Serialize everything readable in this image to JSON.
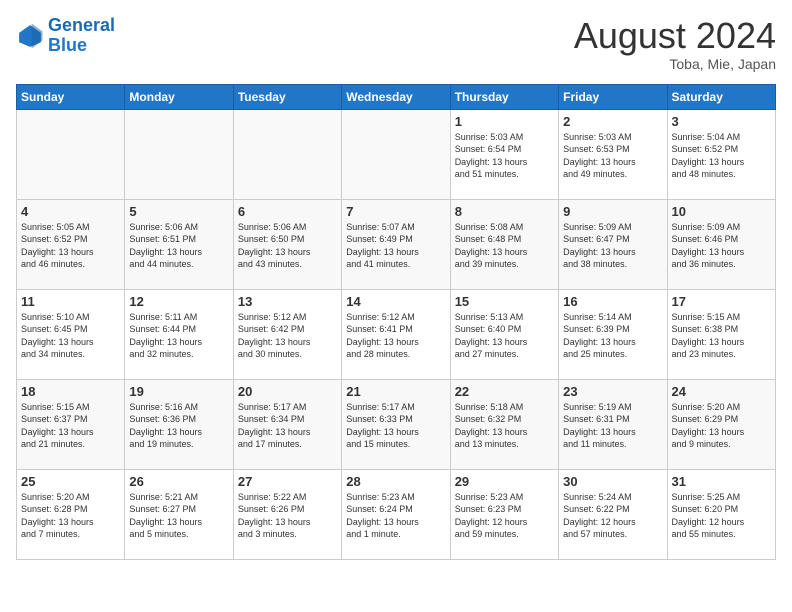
{
  "header": {
    "logo_general": "General",
    "logo_blue": "Blue",
    "month_year": "August 2024",
    "location": "Toba, Mie, Japan"
  },
  "weekdays": [
    "Sunday",
    "Monday",
    "Tuesday",
    "Wednesday",
    "Thursday",
    "Friday",
    "Saturday"
  ],
  "weeks": [
    [
      {
        "day": "",
        "info": ""
      },
      {
        "day": "",
        "info": ""
      },
      {
        "day": "",
        "info": ""
      },
      {
        "day": "",
        "info": ""
      },
      {
        "day": "1",
        "info": "Sunrise: 5:03 AM\nSunset: 6:54 PM\nDaylight: 13 hours\nand 51 minutes."
      },
      {
        "day": "2",
        "info": "Sunrise: 5:03 AM\nSunset: 6:53 PM\nDaylight: 13 hours\nand 49 minutes."
      },
      {
        "day": "3",
        "info": "Sunrise: 5:04 AM\nSunset: 6:52 PM\nDaylight: 13 hours\nand 48 minutes."
      }
    ],
    [
      {
        "day": "4",
        "info": "Sunrise: 5:05 AM\nSunset: 6:52 PM\nDaylight: 13 hours\nand 46 minutes."
      },
      {
        "day": "5",
        "info": "Sunrise: 5:06 AM\nSunset: 6:51 PM\nDaylight: 13 hours\nand 44 minutes."
      },
      {
        "day": "6",
        "info": "Sunrise: 5:06 AM\nSunset: 6:50 PM\nDaylight: 13 hours\nand 43 minutes."
      },
      {
        "day": "7",
        "info": "Sunrise: 5:07 AM\nSunset: 6:49 PM\nDaylight: 13 hours\nand 41 minutes."
      },
      {
        "day": "8",
        "info": "Sunrise: 5:08 AM\nSunset: 6:48 PM\nDaylight: 13 hours\nand 39 minutes."
      },
      {
        "day": "9",
        "info": "Sunrise: 5:09 AM\nSunset: 6:47 PM\nDaylight: 13 hours\nand 38 minutes."
      },
      {
        "day": "10",
        "info": "Sunrise: 5:09 AM\nSunset: 6:46 PM\nDaylight: 13 hours\nand 36 minutes."
      }
    ],
    [
      {
        "day": "11",
        "info": "Sunrise: 5:10 AM\nSunset: 6:45 PM\nDaylight: 13 hours\nand 34 minutes."
      },
      {
        "day": "12",
        "info": "Sunrise: 5:11 AM\nSunset: 6:44 PM\nDaylight: 13 hours\nand 32 minutes."
      },
      {
        "day": "13",
        "info": "Sunrise: 5:12 AM\nSunset: 6:42 PM\nDaylight: 13 hours\nand 30 minutes."
      },
      {
        "day": "14",
        "info": "Sunrise: 5:12 AM\nSunset: 6:41 PM\nDaylight: 13 hours\nand 28 minutes."
      },
      {
        "day": "15",
        "info": "Sunrise: 5:13 AM\nSunset: 6:40 PM\nDaylight: 13 hours\nand 27 minutes."
      },
      {
        "day": "16",
        "info": "Sunrise: 5:14 AM\nSunset: 6:39 PM\nDaylight: 13 hours\nand 25 minutes."
      },
      {
        "day": "17",
        "info": "Sunrise: 5:15 AM\nSunset: 6:38 PM\nDaylight: 13 hours\nand 23 minutes."
      }
    ],
    [
      {
        "day": "18",
        "info": "Sunrise: 5:15 AM\nSunset: 6:37 PM\nDaylight: 13 hours\nand 21 minutes."
      },
      {
        "day": "19",
        "info": "Sunrise: 5:16 AM\nSunset: 6:36 PM\nDaylight: 13 hours\nand 19 minutes."
      },
      {
        "day": "20",
        "info": "Sunrise: 5:17 AM\nSunset: 6:34 PM\nDaylight: 13 hours\nand 17 minutes."
      },
      {
        "day": "21",
        "info": "Sunrise: 5:17 AM\nSunset: 6:33 PM\nDaylight: 13 hours\nand 15 minutes."
      },
      {
        "day": "22",
        "info": "Sunrise: 5:18 AM\nSunset: 6:32 PM\nDaylight: 13 hours\nand 13 minutes."
      },
      {
        "day": "23",
        "info": "Sunrise: 5:19 AM\nSunset: 6:31 PM\nDaylight: 13 hours\nand 11 minutes."
      },
      {
        "day": "24",
        "info": "Sunrise: 5:20 AM\nSunset: 6:29 PM\nDaylight: 13 hours\nand 9 minutes."
      }
    ],
    [
      {
        "day": "25",
        "info": "Sunrise: 5:20 AM\nSunset: 6:28 PM\nDaylight: 13 hours\nand 7 minutes."
      },
      {
        "day": "26",
        "info": "Sunrise: 5:21 AM\nSunset: 6:27 PM\nDaylight: 13 hours\nand 5 minutes."
      },
      {
        "day": "27",
        "info": "Sunrise: 5:22 AM\nSunset: 6:26 PM\nDaylight: 13 hours\nand 3 minutes."
      },
      {
        "day": "28",
        "info": "Sunrise: 5:23 AM\nSunset: 6:24 PM\nDaylight: 13 hours\nand 1 minute."
      },
      {
        "day": "29",
        "info": "Sunrise: 5:23 AM\nSunset: 6:23 PM\nDaylight: 12 hours\nand 59 minutes."
      },
      {
        "day": "30",
        "info": "Sunrise: 5:24 AM\nSunset: 6:22 PM\nDaylight: 12 hours\nand 57 minutes."
      },
      {
        "day": "31",
        "info": "Sunrise: 5:25 AM\nSunset: 6:20 PM\nDaylight: 12 hours\nand 55 minutes."
      }
    ]
  ]
}
